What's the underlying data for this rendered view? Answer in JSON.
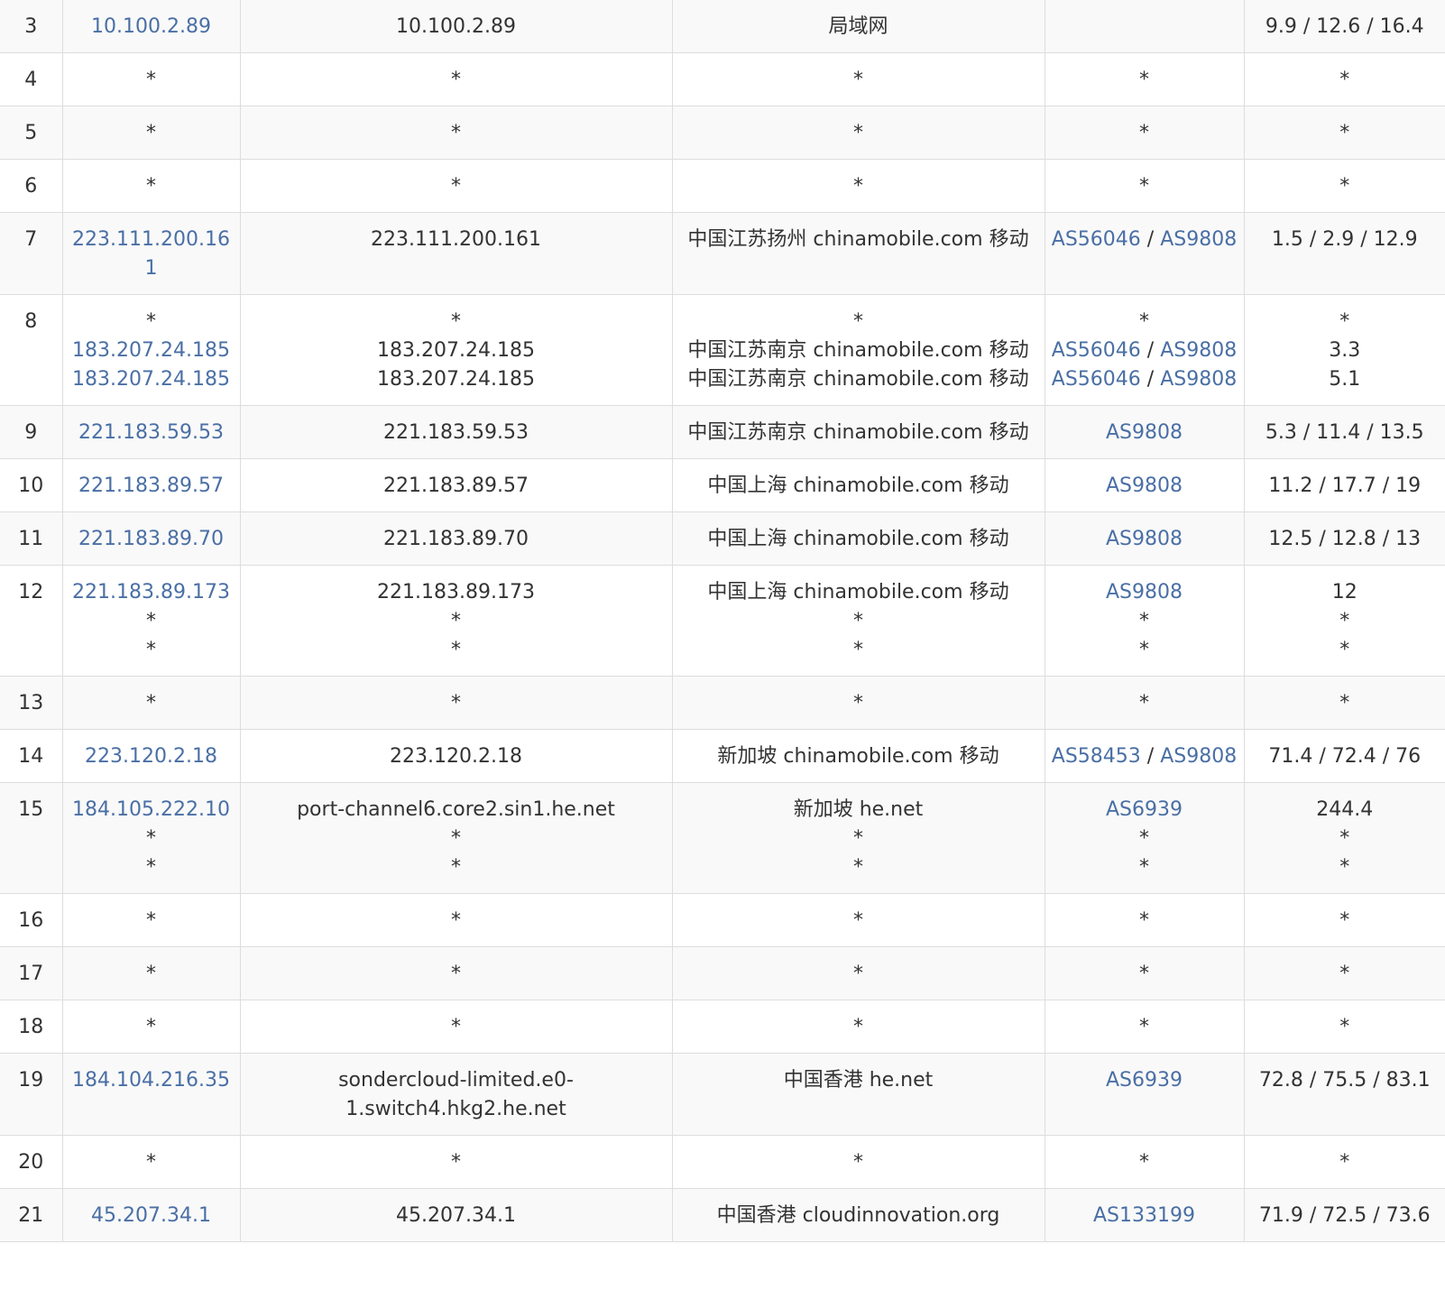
{
  "rows": [
    {
      "hop": "3",
      "ip": [
        "10.100.2.89"
      ],
      "host": [
        "10.100.2.89"
      ],
      "loc": [
        "局域网"
      ],
      "asn": [
        []
      ],
      "lat": [
        "9.9 / 12.6 / 16.4"
      ]
    },
    {
      "hop": "4",
      "ip": [
        "*"
      ],
      "host": [
        "*"
      ],
      "loc": [
        "*"
      ],
      "asn": [
        [
          "*"
        ]
      ],
      "lat": [
        "*"
      ]
    },
    {
      "hop": "5",
      "ip": [
        "*"
      ],
      "host": [
        "*"
      ],
      "loc": [
        "*"
      ],
      "asn": [
        [
          "*"
        ]
      ],
      "lat": [
        "*"
      ]
    },
    {
      "hop": "6",
      "ip": [
        "*"
      ],
      "host": [
        "*"
      ],
      "loc": [
        "*"
      ],
      "asn": [
        [
          "*"
        ]
      ],
      "lat": [
        "*"
      ]
    },
    {
      "hop": "7",
      "ip": [
        "223.111.200.161"
      ],
      "host": [
        "223.111.200.161"
      ],
      "loc": [
        "中国江苏扬州 chinamobile.com 移动"
      ],
      "asn": [
        [
          "AS56046",
          "AS9808"
        ]
      ],
      "lat": [
        "1.5 / 2.9 / 12.9"
      ]
    },
    {
      "hop": "8",
      "ip": [
        "*",
        "183.207.24.185",
        "183.207.24.185"
      ],
      "host": [
        "*",
        "183.207.24.185",
        "183.207.24.185"
      ],
      "loc": [
        "*",
        "中国江苏南京 chinamobile.com 移动",
        "中国江苏南京 chinamobile.com 移动"
      ],
      "asn": [
        [
          "*"
        ],
        [
          "AS56046",
          "AS9808"
        ],
        [
          "AS56046",
          "AS9808"
        ]
      ],
      "lat": [
        "*",
        "3.3",
        "5.1"
      ]
    },
    {
      "hop": "9",
      "ip": [
        "221.183.59.53"
      ],
      "host": [
        "221.183.59.53"
      ],
      "loc": [
        "中国江苏南京 chinamobile.com 移动"
      ],
      "asn": [
        [
          "AS9808"
        ]
      ],
      "lat": [
        "5.3 / 11.4 / 13.5"
      ]
    },
    {
      "hop": "10",
      "ip": [
        "221.183.89.57"
      ],
      "host": [
        "221.183.89.57"
      ],
      "loc": [
        "中国上海 chinamobile.com 移动"
      ],
      "asn": [
        [
          "AS9808"
        ]
      ],
      "lat": [
        "11.2 / 17.7 / 19"
      ]
    },
    {
      "hop": "11",
      "ip": [
        "221.183.89.70"
      ],
      "host": [
        "221.183.89.70"
      ],
      "loc": [
        "中国上海 chinamobile.com 移动"
      ],
      "asn": [
        [
          "AS9808"
        ]
      ],
      "lat": [
        "12.5 / 12.8 / 13"
      ]
    },
    {
      "hop": "12",
      "ip": [
        "221.183.89.173",
        "*",
        "*"
      ],
      "host": [
        "221.183.89.173",
        "*",
        "*"
      ],
      "loc": [
        "中国上海 chinamobile.com 移动",
        "*",
        "*"
      ],
      "asn": [
        [
          "AS9808"
        ],
        [
          "*"
        ],
        [
          "*"
        ]
      ],
      "lat": [
        "12",
        "*",
        "*"
      ]
    },
    {
      "hop": "13",
      "ip": [
        "*"
      ],
      "host": [
        "*"
      ],
      "loc": [
        "*"
      ],
      "asn": [
        [
          "*"
        ]
      ],
      "lat": [
        "*"
      ]
    },
    {
      "hop": "14",
      "ip": [
        "223.120.2.18"
      ],
      "host": [
        "223.120.2.18"
      ],
      "loc": [
        "新加坡 chinamobile.com 移动"
      ],
      "asn": [
        [
          "AS58453",
          "AS9808"
        ]
      ],
      "lat": [
        "71.4 / 72.4 / 76"
      ]
    },
    {
      "hop": "15",
      "ip": [
        "184.105.222.10",
        "*",
        "*"
      ],
      "host": [
        "port-channel6.core2.sin1.he.net",
        "*",
        "*"
      ],
      "loc": [
        "新加坡 he.net",
        "*",
        "*"
      ],
      "asn": [
        [
          "AS6939"
        ],
        [
          "*"
        ],
        [
          "*"
        ]
      ],
      "lat": [
        "244.4",
        "*",
        "*"
      ]
    },
    {
      "hop": "16",
      "ip": [
        "*"
      ],
      "host": [
        "*"
      ],
      "loc": [
        "*"
      ],
      "asn": [
        [
          "*"
        ]
      ],
      "lat": [
        "*"
      ]
    },
    {
      "hop": "17",
      "ip": [
        "*"
      ],
      "host": [
        "*"
      ],
      "loc": [
        "*"
      ],
      "asn": [
        [
          "*"
        ]
      ],
      "lat": [
        "*"
      ]
    },
    {
      "hop": "18",
      "ip": [
        "*"
      ],
      "host": [
        "*"
      ],
      "loc": [
        "*"
      ],
      "asn": [
        [
          "*"
        ]
      ],
      "lat": [
        "*"
      ]
    },
    {
      "hop": "19",
      "ip": [
        "184.104.216.35"
      ],
      "host": [
        "sondercloud-limited.e0-1.switch4.hkg2.he.net"
      ],
      "loc": [
        "中国香港 he.net"
      ],
      "asn": [
        [
          "AS6939"
        ]
      ],
      "lat": [
        "72.8 / 75.5 / 83.1"
      ]
    },
    {
      "hop": "20",
      "ip": [
        "*"
      ],
      "host": [
        "*"
      ],
      "loc": [
        "*"
      ],
      "asn": [
        [
          "*"
        ]
      ],
      "lat": [
        "*"
      ]
    },
    {
      "hop": "21",
      "ip": [
        "45.207.34.1"
      ],
      "host": [
        "45.207.34.1"
      ],
      "loc": [
        "中国香港 cloudinnovation.org"
      ],
      "asn": [
        [
          "AS133199"
        ]
      ],
      "lat": [
        "71.9 / 72.5 / 73.6"
      ]
    }
  ]
}
